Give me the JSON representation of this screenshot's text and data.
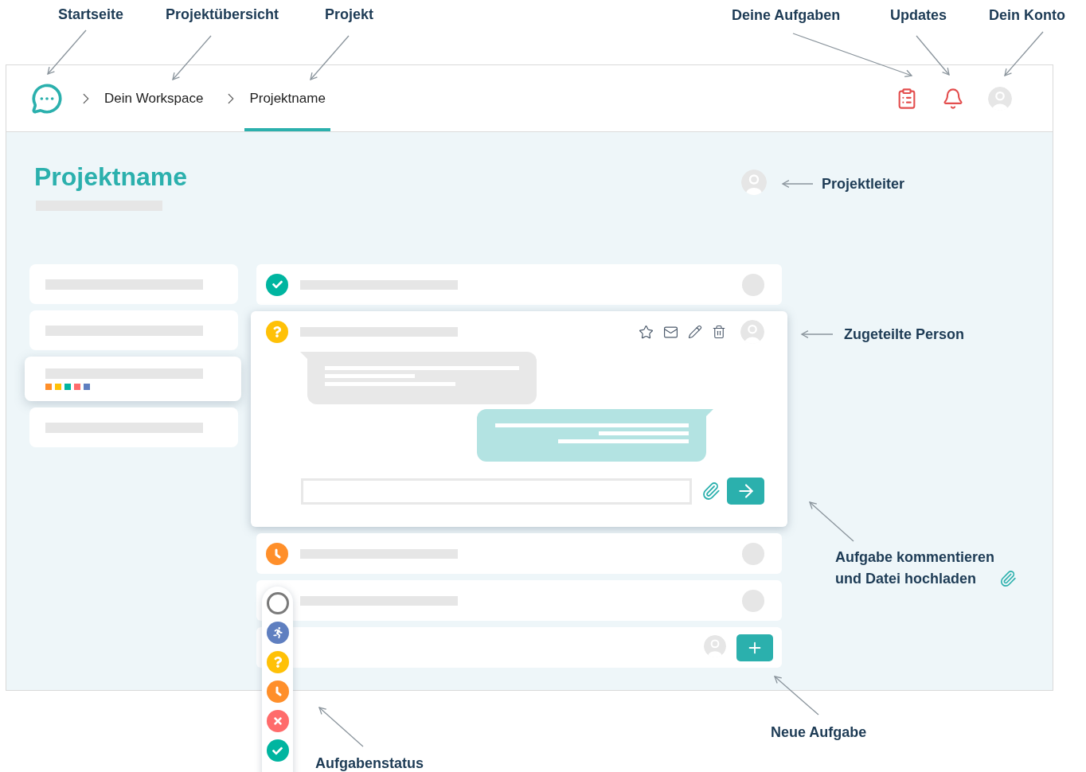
{
  "annotations": [
    {
      "label": "Startseite",
      "kind": "plain"
    },
    {
      "label": "Projektübersicht",
      "kind": "plain"
    },
    {
      "label": "Projekt",
      "kind": "plain"
    },
    {
      "label": "Deine Aufgaben",
      "kind": "plain"
    },
    {
      "label": "Updates",
      "kind": "plain"
    },
    {
      "label": "Dein Konto",
      "kind": "plain"
    },
    {
      "label": "Projektleiter",
      "kind": "plain"
    },
    {
      "label": "Zugeteilte Person",
      "kind": "plain"
    },
    {
      "label": "Aufgabe kommentieren\nund Datei hochladen",
      "kind": "with_clip"
    },
    {
      "label": "Neue Aufgabe",
      "kind": "plain"
    },
    {
      "label": "Aufgabenstatus",
      "kind": "plain"
    }
  ],
  "breadcrumbs": [
    {
      "label": "Dein Workspace",
      "selected": false
    },
    {
      "label": "Projektname",
      "selected": true
    }
  ],
  "project": {
    "title": "Projektname"
  },
  "sidebar": {
    "items": [
      {
        "selected": false
      },
      {
        "selected": false
      },
      {
        "selected": true,
        "tags": [
          {
            "color": "#ff8f2a"
          },
          {
            "color": "#ffc107"
          },
          {
            "color": "#00b5a0"
          },
          {
            "color": "#ff6b6b"
          },
          {
            "color": "#5f7fc0"
          }
        ]
      },
      {
        "selected": false
      }
    ]
  },
  "tasks": [
    {
      "kind": "done",
      "expanded": false
    },
    {
      "kind": "question",
      "expanded": true
    },
    {
      "kind": "waiting",
      "expanded": false
    },
    {
      "kind": "hidden",
      "expanded": false
    },
    {
      "kind": "new"
    }
  ],
  "chat": {
    "messages": [
      {
        "kind": "incoming"
      },
      {
        "kind": "outgoing"
      }
    ]
  },
  "status_menu": {
    "options": [
      {
        "kind": "open"
      },
      {
        "kind": "in_progress"
      },
      {
        "kind": "question"
      },
      {
        "kind": "waiting"
      },
      {
        "kind": "rejected"
      },
      {
        "kind": "done"
      }
    ]
  }
}
